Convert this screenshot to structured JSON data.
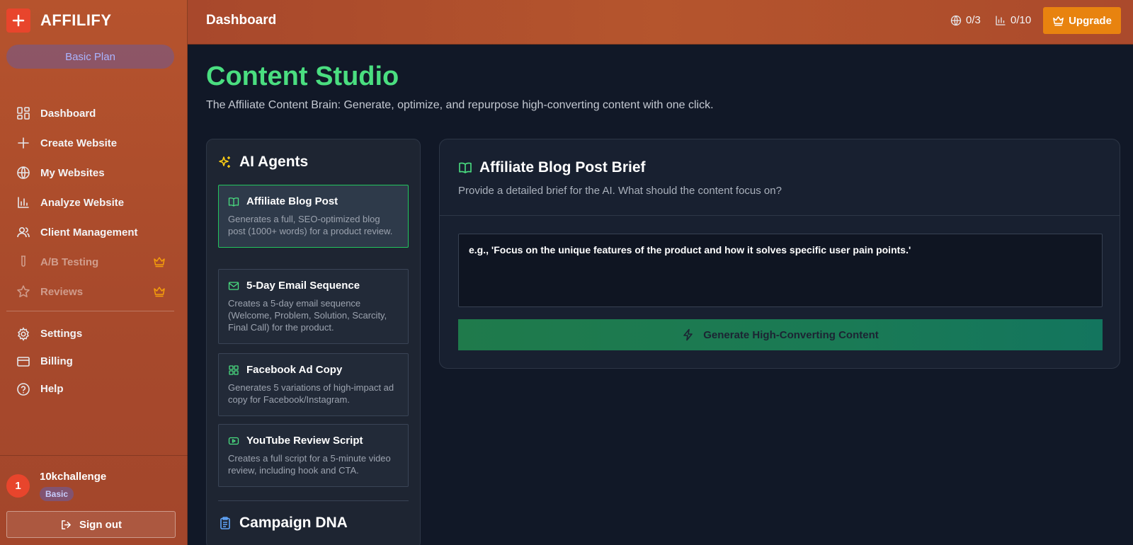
{
  "brand": {
    "name": "AFFILIFY"
  },
  "plan": {
    "label": "Basic Plan"
  },
  "nav": {
    "items": [
      {
        "label": "Dashboard",
        "icon": "grid-icon"
      },
      {
        "label": "Create Website",
        "icon": "plus-icon"
      },
      {
        "label": "My Websites",
        "icon": "globe-icon"
      },
      {
        "label": "Analyze Website",
        "icon": "bar-chart-icon"
      },
      {
        "label": "Client Management",
        "icon": "users-icon"
      },
      {
        "label": "A/B Testing",
        "icon": "test-tube-icon",
        "locked": true
      },
      {
        "label": "Reviews",
        "icon": "star-icon",
        "locked": true
      }
    ],
    "secondary": [
      {
        "label": "Settings",
        "icon": "gear-icon"
      },
      {
        "label": "Billing",
        "icon": "credit-card-icon"
      },
      {
        "label": "Help",
        "icon": "help-circle-icon"
      }
    ]
  },
  "user": {
    "initial": "1",
    "name": "10kchallenge",
    "badge": "Basic"
  },
  "signout": {
    "label": "Sign out"
  },
  "topbar": {
    "title": "Dashboard",
    "websites_stat": "0/3",
    "analyses_stat": "0/10",
    "upgrade_label": "Upgrade"
  },
  "page": {
    "title": "Content Studio",
    "subtitle": "The Affiliate Content Brain: Generate, optimize, and repurpose high-converting content with one click."
  },
  "agents": {
    "heading": "AI Agents",
    "items": [
      {
        "title": "Affiliate Blog Post",
        "desc": "Generates a full, SEO-optimized blog post (1000+ words) for a product review.",
        "icon": "book-open-icon",
        "active": true
      },
      {
        "title": "5-Day Email Sequence",
        "desc": "Creates a 5-day email sequence (Welcome, Problem, Solution, Scarcity, Final Call) for the product.",
        "icon": "mail-icon"
      },
      {
        "title": "Facebook Ad Copy",
        "desc": "Generates 5 variations of high-impact ad copy for Facebook/Instagram.",
        "icon": "layout-grid-icon"
      },
      {
        "title": "YouTube Review Script",
        "desc": "Creates a full script for a 5-minute video review, including hook and CTA.",
        "icon": "youtube-icon"
      }
    ],
    "dna_heading": "Campaign DNA"
  },
  "brief": {
    "title": "Affiliate Blog Post Brief",
    "subtitle": "Provide a detailed brief for the AI. What should the content focus on?",
    "placeholder": "e.g., 'Focus on the unique features of the product and how it solves specific user pain points.'",
    "generate_label": "Generate High-Converting Content"
  },
  "colors": {
    "accent_green": "#4ade80",
    "sidebar_orange": "#a84a2c",
    "upgrade_orange": "#e8830f",
    "brand_red": "#e8452c"
  }
}
